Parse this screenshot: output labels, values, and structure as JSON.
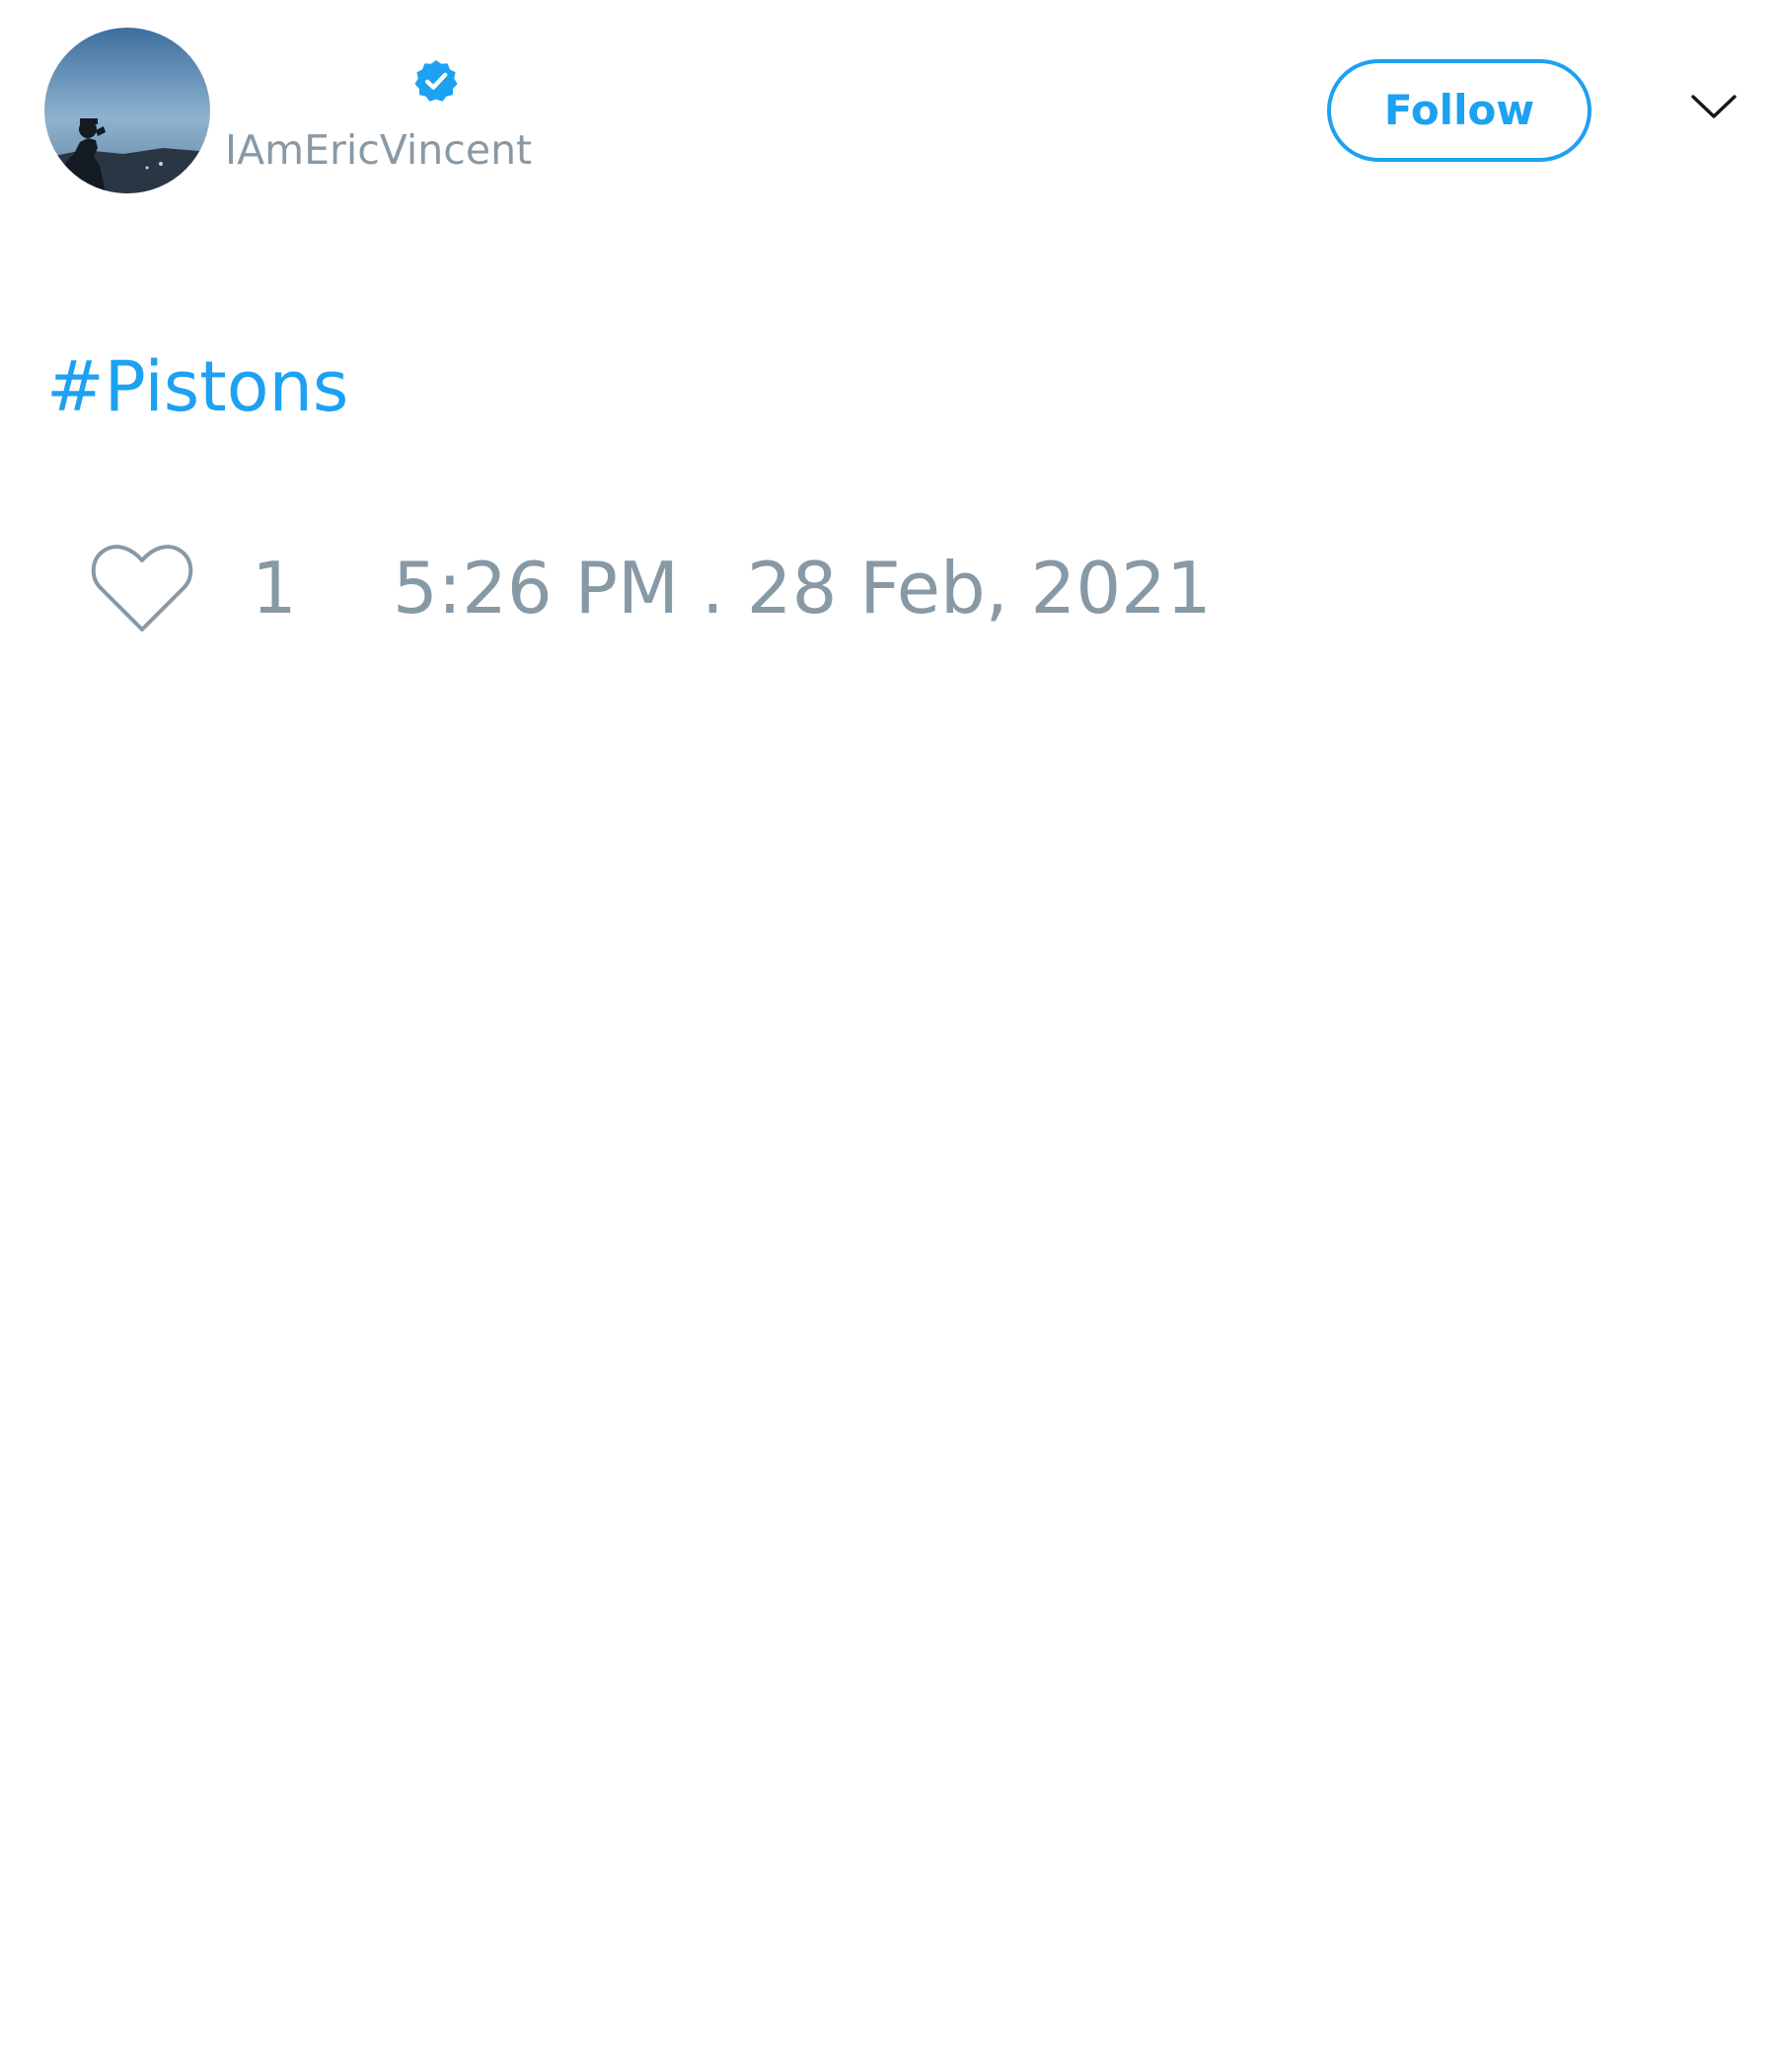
{
  "tweet": {
    "author": {
      "handle": "IAmEricVincent",
      "avatar_icon": "avatar-photo",
      "verified_icon": "verified-badge-icon"
    },
    "follow_button": {
      "label": "Follow"
    },
    "menu_icon": "chevron-down-icon",
    "text": "#Pistons",
    "like_icon": "heart-icon",
    "like_count": "1",
    "timestamp": "5:26 PM . 28 Feb, 2021"
  },
  "colors": {
    "accent": "#1DA1F2",
    "muted": "#8899A6",
    "background": "#FFFFFF",
    "icon_dark": "#14171A"
  }
}
